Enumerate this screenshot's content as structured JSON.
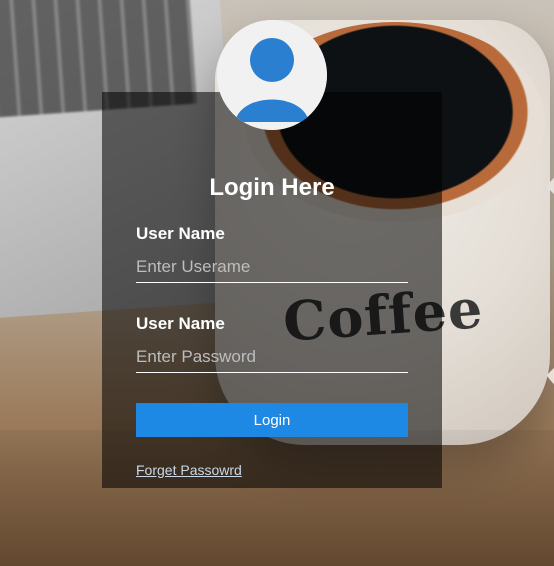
{
  "login": {
    "title": "Login Here",
    "username_label": "User Name",
    "username_placeholder": "Enter Userame",
    "password_label": "User Name",
    "password_placeholder": "Enter Password",
    "login_button": "Login",
    "forgot_link": "Forget Passowrd"
  },
  "background": {
    "mug_text": "Coffee"
  },
  "colors": {
    "accent": "#1e88e5",
    "panel": "rgba(0,0,0,0.55)",
    "avatar": "#2a7fd0"
  }
}
